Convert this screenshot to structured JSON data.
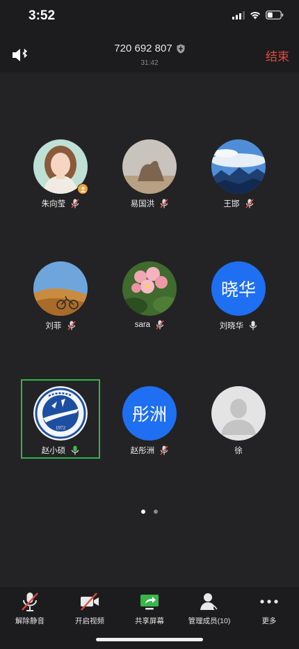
{
  "status_bar": {
    "time": "3:52"
  },
  "header": {
    "meeting_id": "720 692 807",
    "duration": "31:42",
    "end_label": "结束"
  },
  "participants": [
    {
      "name": "朱向莹",
      "mic": "muted",
      "host": true
    },
    {
      "name": "易国洪",
      "mic": "muted"
    },
    {
      "name": "王邯",
      "mic": "muted"
    },
    {
      "name": "刘菲",
      "mic": "muted"
    },
    {
      "name": "sara",
      "mic": "muted"
    },
    {
      "name": "刘晓华",
      "mic": "on",
      "avatar_text": "晓华"
    },
    {
      "name": "赵小硕",
      "mic": "active",
      "speaking": true,
      "logo_text": "1972"
    },
    {
      "name": "赵彤洲",
      "mic": "muted",
      "avatar_text": "彤洲"
    },
    {
      "name": "徐",
      "mic": "none"
    }
  ],
  "pager": {
    "pages": 2,
    "current": 1
  },
  "toolbar": {
    "unmute": "解除静音",
    "start_video": "开启视频",
    "share_screen": "共享屏幕",
    "manage_members": "管理成员(10)",
    "more": "更多"
  },
  "colors": {
    "background": "#232325",
    "bar": "#1c1c1e",
    "end": "#e8453c",
    "active_border": "#2fb546",
    "text_avatar": "#1f6ff2",
    "muted_red": "#e04a3f",
    "mic_green": "#3ac14e"
  }
}
